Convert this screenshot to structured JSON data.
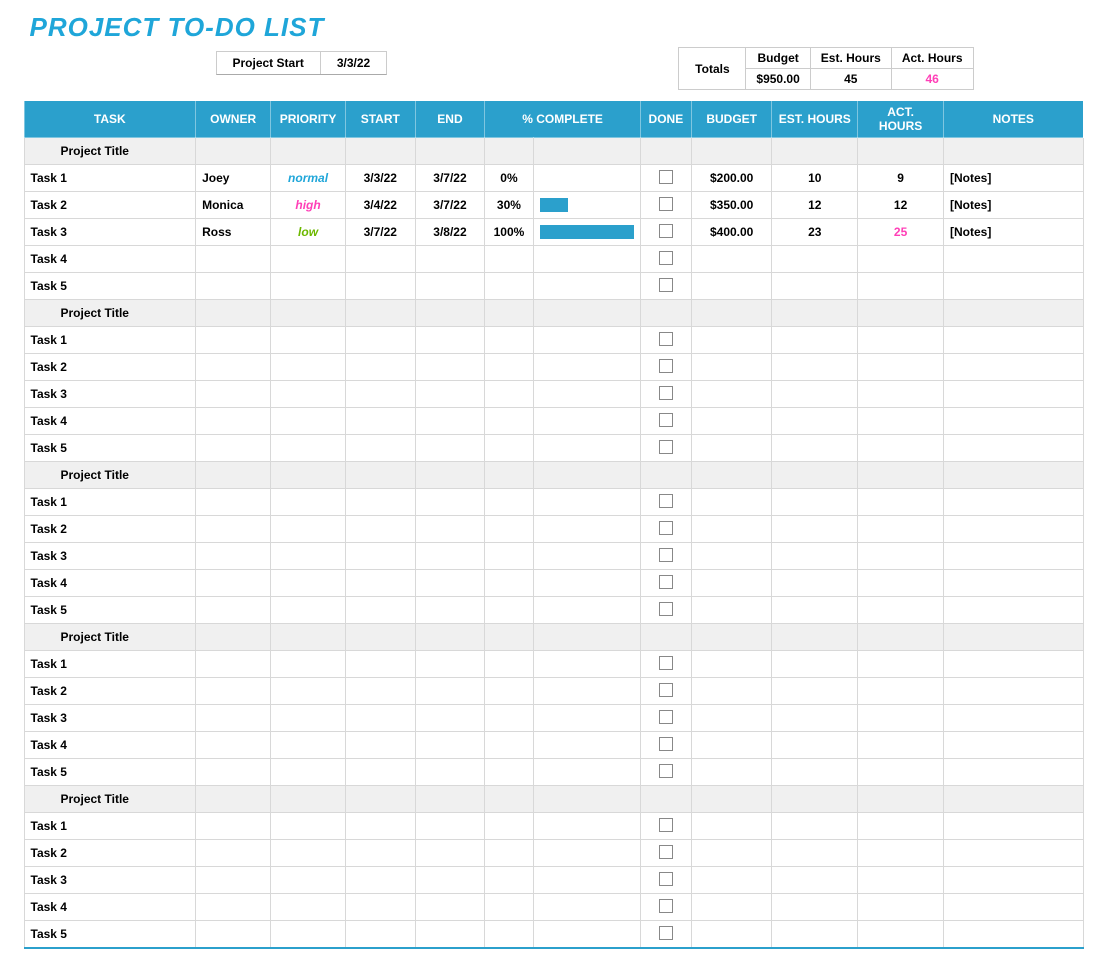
{
  "title": "PROJECT TO-DO LIST",
  "project_start": {
    "label": "Project Start",
    "value": "3/3/22"
  },
  "totals": {
    "label": "Totals",
    "budget_label": "Budget",
    "budget": "$950.00",
    "est_label": "Est. Hours",
    "est": "45",
    "act_label": "Act. Hours",
    "act": "46"
  },
  "columns": {
    "task": "TASK",
    "owner": "OWNER",
    "priority": "PRIORITY",
    "start": "START",
    "end": "END",
    "pct": "% COMPLETE",
    "done": "DONE",
    "budget": "BUDGET",
    "est": "EST. HOURS",
    "act": "ACT. HOURS",
    "notes": "NOTES"
  },
  "groups": [
    {
      "title": "Project Title",
      "rows": [
        {
          "task": "Task 1",
          "owner": "Joey",
          "priority": "normal",
          "pri_class": "pri-normal",
          "start": "3/3/22",
          "end": "3/7/22",
          "pct": "0%",
          "bar_pct": 0,
          "done": false,
          "budget": "$200.00",
          "est": "10",
          "act": "9",
          "act_pink": false,
          "notes": "[Notes]"
        },
        {
          "task": "Task 2",
          "owner": "Monica",
          "priority": "high",
          "pri_class": "pri-high",
          "start": "3/4/22",
          "end": "3/7/22",
          "pct": "30%",
          "bar_pct": 30,
          "done": false,
          "budget": "$350.00",
          "est": "12",
          "act": "12",
          "act_pink": false,
          "notes": "[Notes]"
        },
        {
          "task": "Task 3",
          "owner": "Ross",
          "priority": "low",
          "pri_class": "pri-low",
          "start": "3/7/22",
          "end": "3/8/22",
          "pct": "100%",
          "bar_pct": 100,
          "done": false,
          "budget": "$400.00",
          "est": "23",
          "act": "25",
          "act_pink": true,
          "notes": "[Notes]"
        },
        {
          "task": "Task 4"
        },
        {
          "task": "Task 5"
        }
      ]
    },
    {
      "title": "Project Title",
      "rows": [
        {
          "task": "Task 1"
        },
        {
          "task": "Task 2"
        },
        {
          "task": "Task 3"
        },
        {
          "task": "Task 4"
        },
        {
          "task": "Task 5"
        }
      ]
    },
    {
      "title": "Project Title",
      "rows": [
        {
          "task": "Task 1"
        },
        {
          "task": "Task 2"
        },
        {
          "task": "Task 3"
        },
        {
          "task": "Task 4"
        },
        {
          "task": "Task 5"
        }
      ]
    },
    {
      "title": "Project Title",
      "rows": [
        {
          "task": "Task 1"
        },
        {
          "task": "Task 2"
        },
        {
          "task": "Task 3"
        },
        {
          "task": "Task 4"
        },
        {
          "task": "Task 5"
        }
      ]
    },
    {
      "title": "Project Title",
      "rows": [
        {
          "task": "Task 1"
        },
        {
          "task": "Task 2"
        },
        {
          "task": "Task 3"
        },
        {
          "task": "Task 4"
        },
        {
          "task": "Task 5"
        }
      ]
    }
  ]
}
